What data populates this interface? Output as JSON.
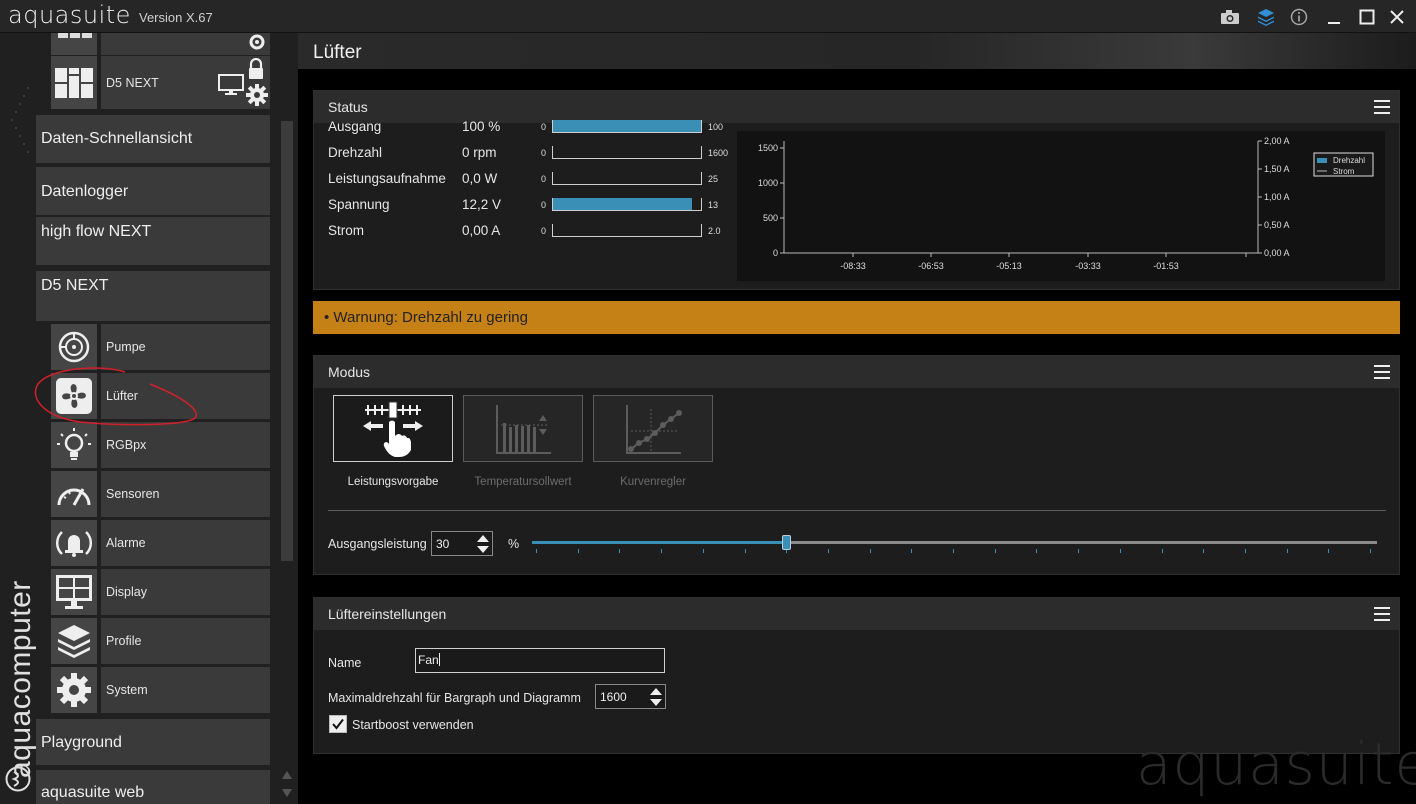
{
  "titlebar": {
    "app_name": "aquasuite",
    "version": "Version X.67",
    "icons": [
      "camera-icon",
      "layers-icon",
      "info-icon",
      "minimize-icon",
      "maximize-icon",
      "close-icon"
    ]
  },
  "sidebar": {
    "brand": "aquacomputer",
    "top_device_label": "D5 NEXT",
    "items": [
      {
        "label": "Daten-Schnellansicht"
      },
      {
        "label": "Datenlogger"
      },
      {
        "label": "high flow NEXT"
      },
      {
        "label": "D5 NEXT"
      },
      {
        "label": "Playground"
      },
      {
        "label": "aquasuite web"
      }
    ],
    "sub_items": [
      {
        "label": "Pumpe",
        "icon": "pump-icon"
      },
      {
        "label": "Lüfter",
        "icon": "fan-icon"
      },
      {
        "label": "RGBpx",
        "icon": "bulb-icon"
      },
      {
        "label": "Sensoren",
        "icon": "gauge-icon"
      },
      {
        "label": "Alarme",
        "icon": "bell-icon"
      },
      {
        "label": "Display",
        "icon": "display-icon"
      },
      {
        "label": "Profile",
        "icon": "layers-icon"
      },
      {
        "label": "System",
        "icon": "gear-icon"
      }
    ],
    "highlight_color": "#d0202a"
  },
  "main": {
    "title": "Lüfter",
    "status": {
      "title": "Status",
      "rows": [
        {
          "label": "Ausgang",
          "value": "100 %",
          "min": "0",
          "max": "100",
          "fill": 1.0
        },
        {
          "label": "Drehzahl",
          "value": "0 rpm",
          "min": "0",
          "max": "1600",
          "fill": 0.0
        },
        {
          "label": "Leistungsaufnahme",
          "value": "0,0 W",
          "min": "0",
          "max": "25",
          "fill": 0.0
        },
        {
          "label": "Spannung",
          "value": "12,2 V",
          "min": "0",
          "max": "13",
          "fill": 0.94
        },
        {
          "label": "Strom",
          "value": "0,00 A",
          "min": "0",
          "max": "2.0",
          "fill": 0.0
        }
      ]
    },
    "warning": "• Warnung: Drehzahl zu gering",
    "modus": {
      "title": "Modus",
      "modes": [
        {
          "label": "Leistungsvorgabe",
          "active": true
        },
        {
          "label": "Temperatursollwert",
          "active": false
        },
        {
          "label": "Kurvenregler",
          "active": false
        }
      ],
      "output_label": "Ausgangsleistung",
      "output_value": "30",
      "unit": "%",
      "slider_value": 30,
      "slider_max": 100
    },
    "settings": {
      "title": "Lüftereinstellungen",
      "name_label": "Name",
      "name_value": "Fan",
      "max_label": "Maximaldrehzahl für Bargraph und Diagramm",
      "max_value": "1600",
      "startboost_label": "Startboost verwenden",
      "startboost_checked": true
    },
    "watermark": "aquasuite"
  },
  "colors": {
    "accent": "#3a8fb7",
    "warning": "#c68116"
  },
  "chart_data": {
    "type": "line",
    "title": "",
    "x_ticks": [
      "-08:33",
      "-06:53",
      "-05:13",
      "-03:33",
      "-01:53"
    ],
    "y_left_ticks": [
      "0",
      "500",
      "1000",
      "1500"
    ],
    "y_right_ticks": [
      "0,00 A",
      "0,50 A",
      "1,00 A",
      "1,50 A",
      "2,00 A"
    ],
    "ylim_left": [
      0,
      1600
    ],
    "ylim_right": [
      0,
      2.0
    ],
    "series": [
      {
        "name": "Drehzahl",
        "color": "#3a8fb7",
        "values": []
      },
      {
        "name": "Strom",
        "color": "#bbbbbb",
        "values": []
      }
    ],
    "legend_position": "top-right",
    "grid": false
  }
}
